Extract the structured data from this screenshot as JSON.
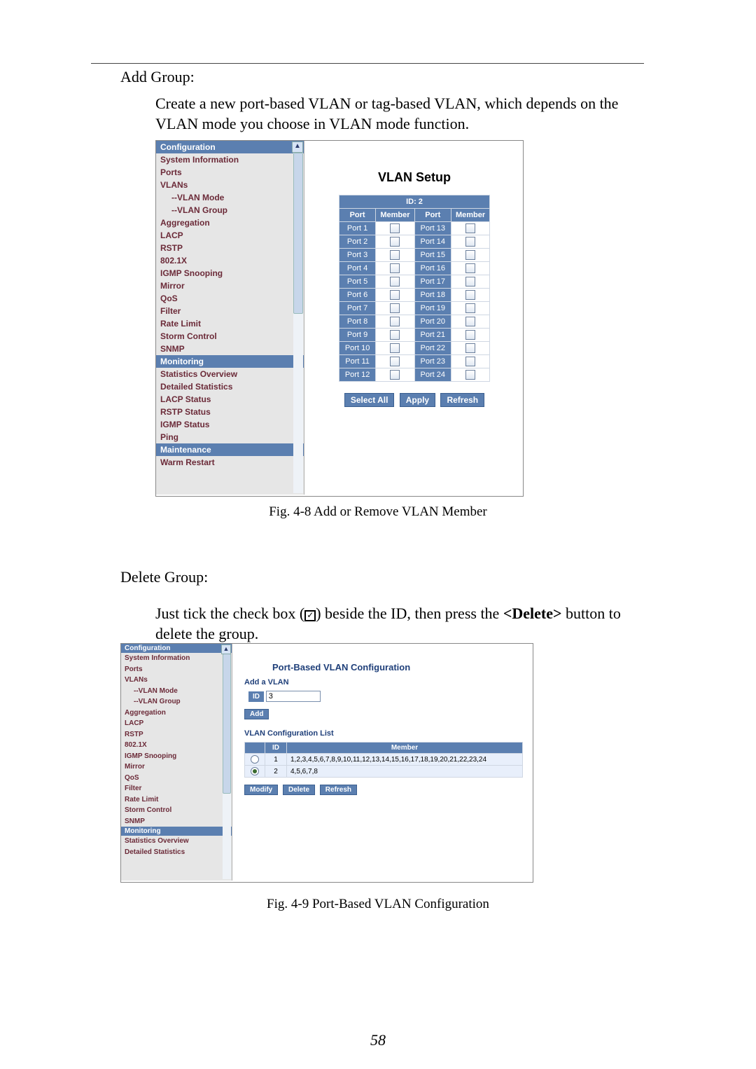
{
  "page_number": "58",
  "section1": {
    "heading": "Add Group:",
    "desc": "Create a new port-based VLAN or tag-based VLAN, which depends on the VLAN mode you choose in VLAN mode function."
  },
  "fig1": {
    "caption": "Fig. 4-8 Add or Remove VLAN Member",
    "nav": {
      "headers": {
        "config": "Configuration",
        "monitoring": "Monitoring",
        "maintenance": "Maintenance"
      },
      "items_config": [
        "System Information",
        "Ports",
        "VLANs",
        "--VLAN Mode",
        "--VLAN Group",
        "Aggregation",
        "LACP",
        "RSTP",
        "802.1X",
        "IGMP Snooping",
        "Mirror",
        "QoS",
        "Filter",
        "Rate Limit",
        "Storm Control",
        "SNMP"
      ],
      "items_monitoring": [
        "Statistics Overview",
        "Detailed Statistics",
        "LACP Status",
        "RSTP Status",
        "IGMP Status",
        "Ping"
      ],
      "items_maintenance": [
        "Warm Restart"
      ]
    },
    "main": {
      "title": "VLAN Setup",
      "id_label": "ID: 2",
      "cols": {
        "port": "Port",
        "member": "Member"
      },
      "ports_left": [
        "Port 1",
        "Port 2",
        "Port 3",
        "Port 4",
        "Port 5",
        "Port 6",
        "Port 7",
        "Port 8",
        "Port 9",
        "Port 10",
        "Port 11",
        "Port 12"
      ],
      "ports_right": [
        "Port 13",
        "Port 14",
        "Port 15",
        "Port 16",
        "Port 17",
        "Port 18",
        "Port 19",
        "Port 20",
        "Port 21",
        "Port 22",
        "Port 23",
        "Port 24"
      ],
      "buttons": {
        "select_all": "Select All",
        "apply": "Apply",
        "refresh": "Refresh"
      }
    }
  },
  "section2": {
    "heading": "Delete Group:",
    "desc_before": "Just tick the check box (",
    "desc_after_chk": ") beside the ID, then press the ",
    "delete_btn_label": "<Delete>",
    "desc_tail": " button to delete the group."
  },
  "fig2": {
    "caption": "Fig. 4-9 Port-Based VLAN Configuration",
    "nav": {
      "headers": {
        "config": "Configuration",
        "monitoring": "Monitoring"
      },
      "items_config": [
        "System Information",
        "Ports",
        "VLANs",
        "--VLAN Mode",
        "--VLAN Group",
        "Aggregation",
        "LACP",
        "RSTP",
        "802.1X",
        "IGMP Snooping",
        "Mirror",
        "QoS",
        "Filter",
        "Rate Limit",
        "Storm Control",
        "SNMP"
      ],
      "items_monitoring": [
        "Statistics Overview",
        "Detailed Statistics"
      ]
    },
    "main": {
      "title": "Port-Based VLAN Configuration",
      "add_heading": "Add a VLAN",
      "id_label": "ID",
      "id_value": "3",
      "add_btn": "Add",
      "list_heading": "VLAN Configuration List",
      "cols": {
        "sel": "",
        "id": "ID",
        "member": "Member"
      },
      "rows": [
        {
          "selected": false,
          "id": "1",
          "member": "1,2,3,4,5,6,7,8,9,10,11,12,13,14,15,16,17,18,19,20,21,22,23,24"
        },
        {
          "selected": true,
          "id": "2",
          "member": "4,5,6,7,8"
        }
      ],
      "buttons": {
        "modify": "Modify",
        "delete": "Delete",
        "refresh": "Refresh"
      }
    }
  }
}
